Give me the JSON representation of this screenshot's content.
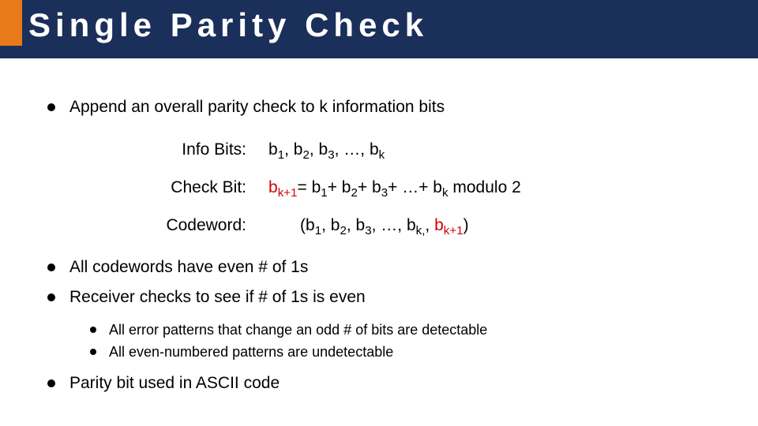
{
  "title": "Single Parity Check",
  "bullets": {
    "append": "Append an overall parity check to k information bits",
    "even": "All codewords have even # of 1s",
    "receiver": "Receiver checks to see if # of 1s is even",
    "sub_odd": "All error patterns that change an odd # of bits are detectable",
    "sub_even": "All even-numbered patterns are undetectable",
    "ascii": "Parity bit used in ASCII code"
  },
  "defs": {
    "info_label": "Info Bits:",
    "check_label": "Check Bit:",
    "codeword_label": "Codeword:",
    "info_val_prefix": "b",
    "ellipsis": ", …, ",
    "comma": ", ",
    "eq": "= ",
    "plus": "+ ",
    "plus_ell": "+ …+ ",
    "mod": "   modulo 2",
    "open": "(",
    "close": ")",
    "subs": {
      "one": "1",
      "two": "2",
      "three": "3",
      "k": "k",
      "kplus1": "k+1",
      "kcomma": "k,"
    }
  }
}
